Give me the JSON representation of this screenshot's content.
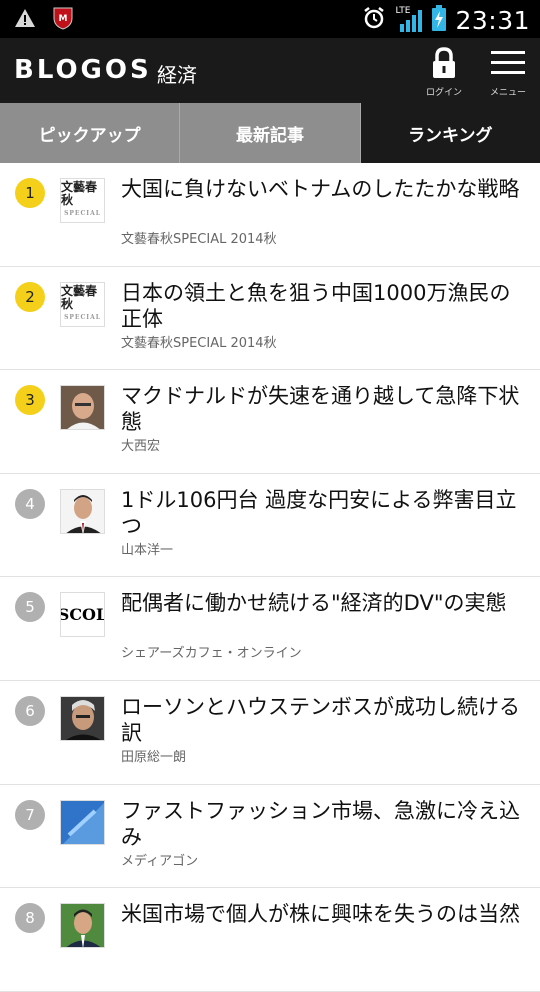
{
  "statusbar": {
    "time": "23:31",
    "network": "LTE",
    "icons": [
      "warning-icon",
      "mcafee-icon",
      "alarm-icon",
      "signal-icon",
      "battery-icon"
    ]
  },
  "header": {
    "brand": "BLOGOS",
    "section": "経済",
    "login_label": "ログイン",
    "menu_label": "メニュー"
  },
  "tabs": [
    {
      "label": "ピックアップ"
    },
    {
      "label": "最新記事"
    },
    {
      "label": "ランキング"
    }
  ],
  "articles": [
    {
      "rank": "1",
      "title": "大国に負けないベトナムのしたたかな戦略",
      "source": "文藝春秋SPECIAL 2014秋",
      "thumb": "文藝春秋"
    },
    {
      "rank": "2",
      "title": "日本の領土と魚を狙う中国1000万漁民の正体",
      "source": "文藝春秋SPECIAL 2014秋",
      "thumb": "文藝春秋"
    },
    {
      "rank": "3",
      "title": "マクドナルドが失速を通り越して急降下状態",
      "source": "大西宏",
      "thumb": ""
    },
    {
      "rank": "4",
      "title": "1ドル106円台 過度な円安による弊害目立つ",
      "source": "山本洋一",
      "thumb": ""
    },
    {
      "rank": "5",
      "title": "配偶者に働かせ続ける\"経済的DV\"の実態",
      "source": "シェアーズカフェ・オンライン",
      "thumb": "SCOL"
    },
    {
      "rank": "6",
      "title": "ローソンとハウステンボスが成功し続ける訳",
      "source": "田原総一朗",
      "thumb": ""
    },
    {
      "rank": "7",
      "title": "ファストファッション市場、急激に冷え込み",
      "source": "メディアゴン",
      "thumb": ""
    },
    {
      "rank": "8",
      "title": "米国市場で個人が株に興味を失うのは当然",
      "source": "",
      "thumb": ""
    }
  ],
  "colors": {
    "gold_rank": "#f4d01b",
    "gray_rank": "#b0b0b0",
    "header_bg": "#1a1a1a",
    "tab_inactive": "#8e8e8e"
  }
}
